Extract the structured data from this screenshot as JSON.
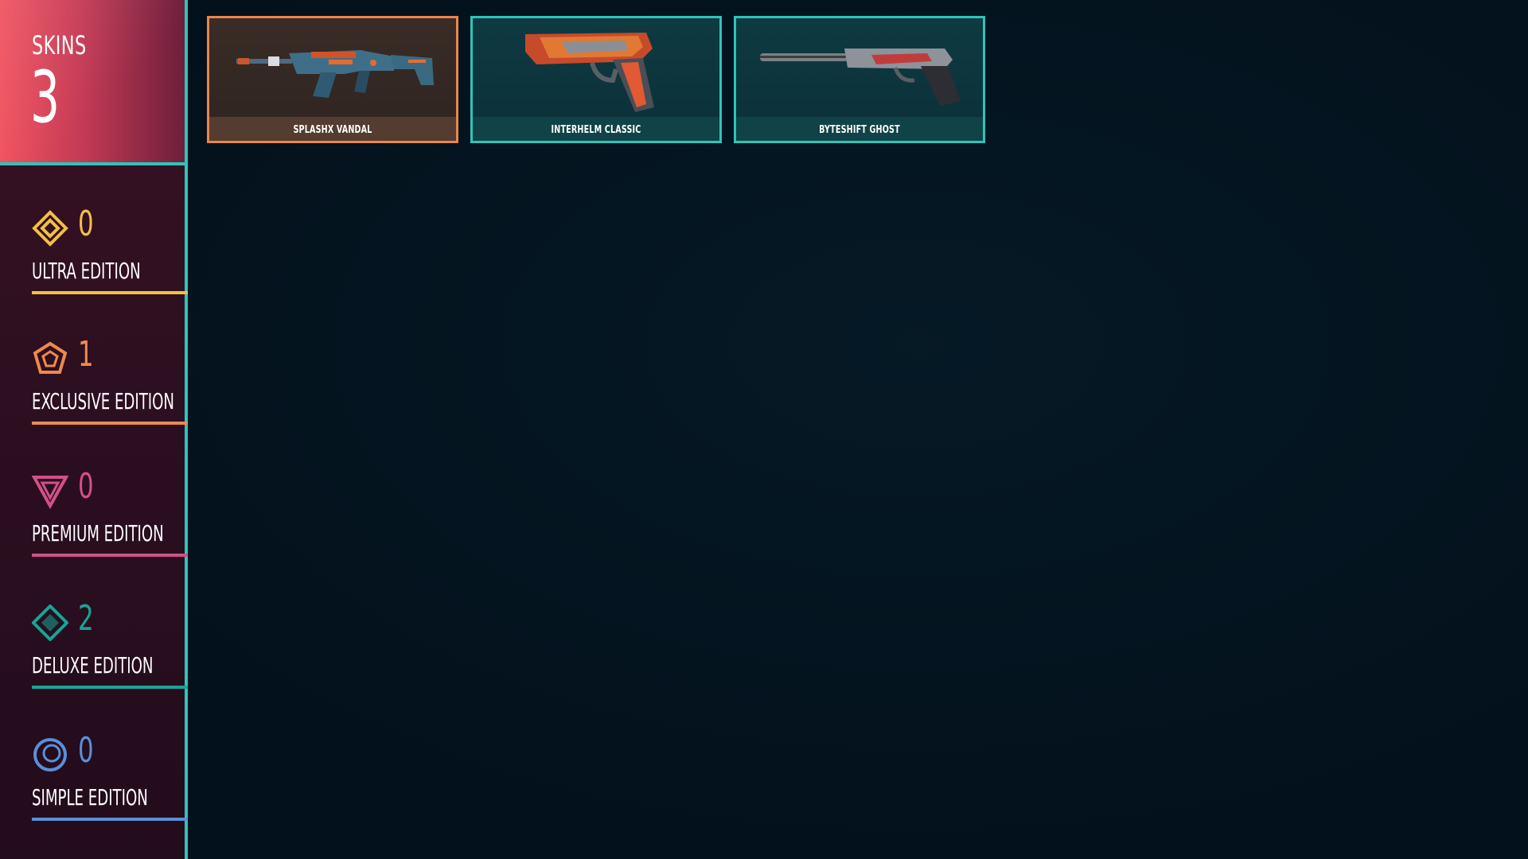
{
  "sidebar": {
    "skins_title": "SKINS",
    "skins_count": "3",
    "editions": [
      {
        "count": "0",
        "label": "ULTRA EDITION",
        "color": "#f2c044",
        "icon": "ultra-edition-icon"
      },
      {
        "count": "1",
        "label": "EXCLUSIVE EDITION",
        "color": "#ef8a4c",
        "icon": "exclusive-edition-icon"
      },
      {
        "count": "0",
        "label": "PREMIUM EDITION",
        "color": "#d2508a",
        "icon": "premium-edition-icon"
      },
      {
        "count": "2",
        "label": "DELUXE EDITION",
        "color": "#16a596",
        "icon": "deluxe-edition-icon"
      },
      {
        "count": "0",
        "label": "SIMPLE EDITION",
        "color": "#5a8fd8",
        "icon": "simple-edition-icon"
      }
    ]
  },
  "skins": [
    {
      "name": "SPLASHX VANDAL",
      "edition": "exclusive",
      "selected": true
    },
    {
      "name": "INTERHELM CLASSIC",
      "edition": "deluxe",
      "selected": false
    },
    {
      "name": "BYTESHIFT GHOST",
      "edition": "deluxe",
      "selected": false
    }
  ],
  "colors": {
    "background": "#03111c",
    "accent_teal": "#2fc4b8",
    "selected_border": "#e8864e",
    "header_gradient_start": "#f0525f"
  }
}
